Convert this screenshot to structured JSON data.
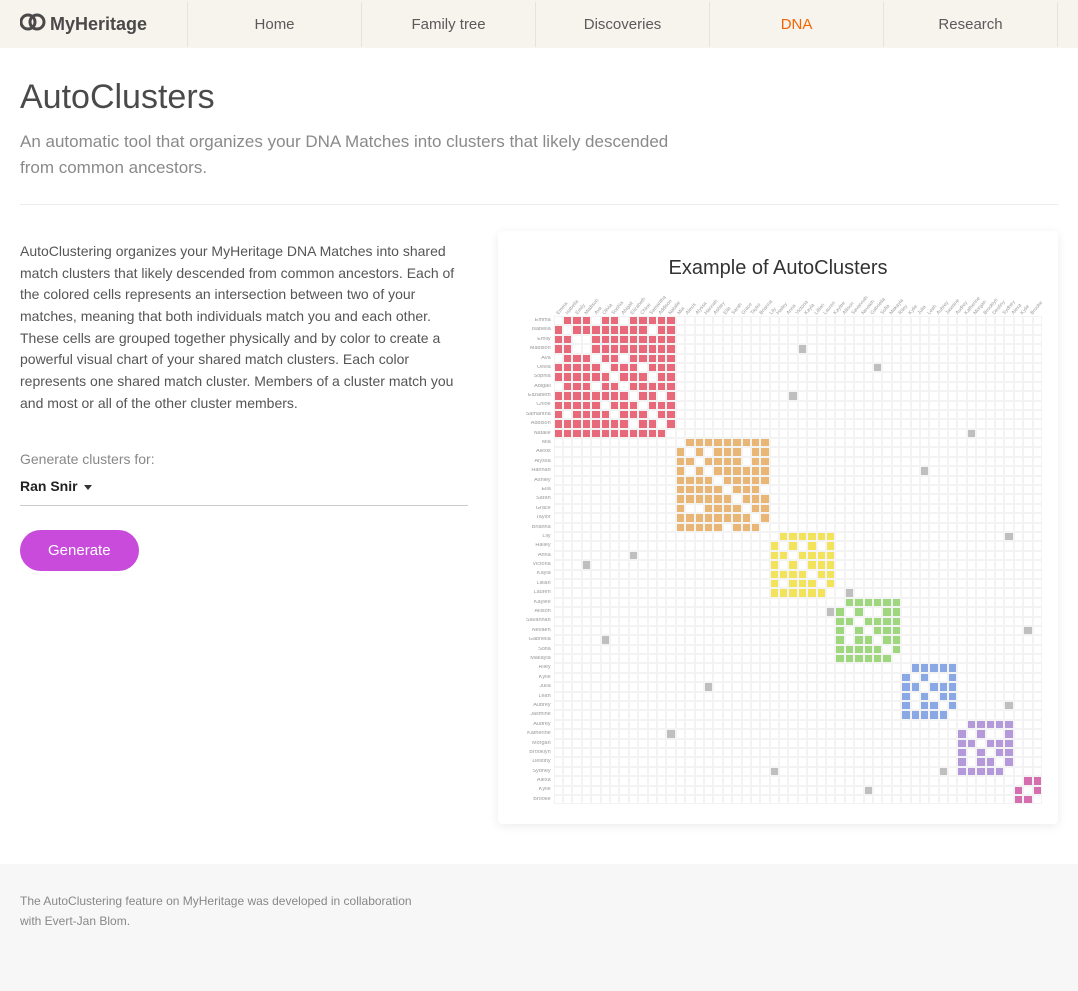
{
  "brand": "MyHeritage",
  "nav": {
    "items": [
      "Home",
      "Family tree",
      "Discoveries",
      "DNA",
      "Research"
    ],
    "active": "DNA"
  },
  "page": {
    "title": "AutoClusters",
    "subtitle": "An automatic tool that organizes your DNA Matches into clusters that likely descended from common ancestors.",
    "description": "AutoClustering organizes your MyHeritage DNA Matches into shared match clusters that likely descended from common ancestors. Each of the colored cells represents an intersection between two of your matches, meaning that both individuals match you and each other. These cells are grouped together physically and by color to create a powerful visual chart of your shared match clusters. Each color represents one shared match cluster. Members of a cluster match you and most or all of the other cluster members.",
    "form_label": "Generate clusters for:",
    "selected_person": "Ran Snir",
    "generate_label": "Generate",
    "credit": "The AutoClustering feature on MyHeritage was developed in collaboration with Evert-Jan Blom."
  },
  "chart_data": {
    "type": "heatmap",
    "title": "Example of AutoClusters",
    "row_labels": [
      "Emma",
      "Isabella",
      "Emily",
      "Madison",
      "Ava",
      "Olivia",
      "Sophia",
      "Abigail",
      "Elizabeth",
      "Chloe",
      "Samantha",
      "Addison",
      "Natalie",
      "Mia",
      "Alexis",
      "Alyssa",
      "Hannah",
      "Ashley",
      "Ella",
      "Sarah",
      "Grace",
      "Taylor",
      "Brianna",
      "Lily",
      "Hailey",
      "Anna",
      "Victoria",
      "Kayla",
      "Lillian",
      "Lauren",
      "Kaylee",
      "Allison",
      "Savannah",
      "Nevaeh",
      "Gabriella",
      "Sofia",
      "Makayla",
      "Riley",
      "Kylie",
      "Julia",
      "Leah",
      "Aubrey",
      "Jasmine",
      "Audrey",
      "Katherine",
      "Morgan",
      "Brooklyn",
      "Destiny",
      "Sydney",
      "Alexa",
      "Kylie",
      "Brooke"
    ],
    "col_labels": [
      "Emma",
      "Isabella",
      "Emily",
      "Madison",
      "Ava",
      "Olivia",
      "Sophia",
      "Abigail",
      "Elizabeth",
      "Chloe",
      "Samantha",
      "Addison",
      "Natalie",
      "Mia",
      "Alexis",
      "Alyssa",
      "Hannah",
      "Ashley",
      "Ella",
      "Sarah",
      "Grace",
      "Taylor",
      "Brianna",
      "Lily",
      "Hailey",
      "Anna",
      "Victoria",
      "Kayla",
      "Lillian",
      "Lauren",
      "Kaylee",
      "Allison",
      "Savannah",
      "Nevaeh",
      "Gabriella",
      "Sofia",
      "Makayla",
      "Riley",
      "Kylie",
      "Julia",
      "Leah",
      "Aubrey",
      "Jasmine",
      "Audrey",
      "Katherine",
      "Morgan",
      "Brooklyn",
      "Destiny",
      "Sydney",
      "Alexa",
      "Kylie",
      "Brooke"
    ],
    "clusters": [
      {
        "color": "#e8697a",
        "start": 0,
        "end": 12
      },
      {
        "color": "#eab676",
        "start": 13,
        "end": 22
      },
      {
        "color": "#f2e35b",
        "start": 23,
        "end": 29
      },
      {
        "color": "#9fd77f",
        "start": 30,
        "end": 36
      },
      {
        "color": "#8aa8e3",
        "start": 37,
        "end": 42
      },
      {
        "color": "#b59adb",
        "start": 43,
        "end": 48
      },
      {
        "color": "#d66fb0",
        "start": 49,
        "end": 51
      }
    ],
    "gaps": [
      [
        0,
        7
      ],
      [
        1,
        10
      ],
      [
        3,
        2
      ],
      [
        4,
        0
      ],
      [
        5,
        9
      ],
      [
        7,
        4
      ],
      [
        8,
        11
      ],
      [
        10,
        6
      ],
      [
        14,
        20
      ],
      [
        16,
        14
      ],
      [
        18,
        22
      ],
      [
        20,
        15
      ],
      [
        24,
        28
      ],
      [
        26,
        24
      ],
      [
        31,
        34
      ],
      [
        33,
        31
      ],
      [
        38,
        41
      ],
      [
        40,
        38
      ],
      [
        44,
        47
      ],
      [
        46,
        44
      ]
    ],
    "outliers": [
      [
        3,
        26
      ],
      [
        12,
        44
      ],
      [
        16,
        39
      ],
      [
        25,
        8
      ],
      [
        31,
        29
      ],
      [
        34,
        5
      ],
      [
        41,
        48
      ],
      [
        48,
        23
      ],
      [
        50,
        33
      ]
    ],
    "outlier_color": "#bfbfbf"
  }
}
